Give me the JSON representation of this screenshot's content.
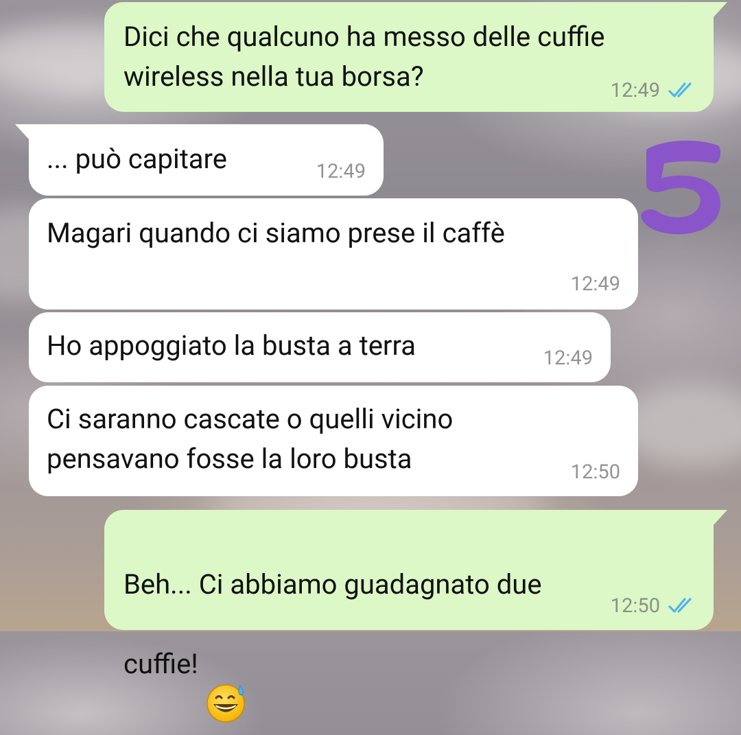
{
  "chat": {
    "messages": [
      {
        "direction": "outgoing",
        "text": "Dici che qualcuno ha messo delle cuffie\nwireless nella tua borsa?",
        "time": "12:49",
        "status": "read-double-check"
      },
      {
        "direction": "incoming",
        "text": "... può capitare",
        "time": "12:49"
      },
      {
        "direction": "incoming",
        "text": "Magari quando ci siamo prese il caffè",
        "time": "12:49"
      },
      {
        "direction": "incoming",
        "text": "Ho appoggiato la busta a terra",
        "time": "12:49"
      },
      {
        "direction": "incoming",
        "text": "Ci saranno cascate o quelli vicino\npensavano fosse la loro busta",
        "time": "12:50"
      },
      {
        "direction": "outgoing",
        "text_line1": "Beh... Ci abbiamo guadagnato due",
        "text_line2": "cuffie!",
        "emoji": "grinning-face-with-sweat-emoji",
        "time": "12:50",
        "status": "read-double-check"
      }
    ]
  },
  "overlay": {
    "number_sticker": "5",
    "number_color": "#8a55c8"
  },
  "colors": {
    "outgoing_bubble": "#dcf8c6",
    "incoming_bubble": "#ffffff",
    "read_ticks": "#4fb6ec",
    "timestamp": "#8a8f8a"
  }
}
